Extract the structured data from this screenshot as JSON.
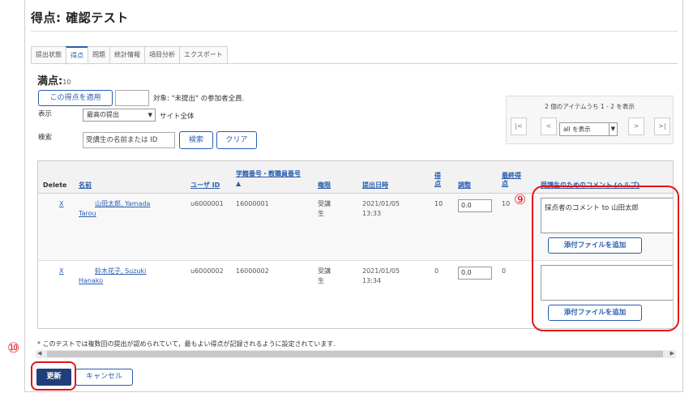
{
  "page": {
    "title": "得点: 確認テスト"
  },
  "tabs": [
    {
      "label": "提出状態",
      "active": false
    },
    {
      "label": "得点",
      "active": true
    },
    {
      "label": "問題",
      "active": false
    },
    {
      "label": "統計情報",
      "active": false
    },
    {
      "label": "項目分析",
      "active": false
    },
    {
      "label": "エクスポート",
      "active": false
    }
  ],
  "fullmarks": {
    "label": "満点:",
    "value": "10"
  },
  "apply": {
    "button": "この得点を適用",
    "value": "",
    "note": "対象: \"未提出\" の参加者全員."
  },
  "display": {
    "label": "表示",
    "selected": "最高の提出",
    "scope": "サイト全体"
  },
  "search": {
    "label": "検索",
    "placeholder": "受講生の名前または ID",
    "button": "検索",
    "clear": "クリア"
  },
  "pager": {
    "info": "2 個のアイテムうち 1 - 2 を表示",
    "first": "|<",
    "prev": "<",
    "next": ">",
    "last": ">|",
    "show_selected": "all を表示"
  },
  "table": {
    "headers": {
      "delete": "Delete",
      "name": "名前",
      "user_id": "ユーザ ID",
      "student_no": "学籍番号・教職員番号",
      "sort": "▲",
      "role": "権限",
      "submitted": "提出日時",
      "score_1": "得",
      "score_2": "点",
      "adjust": "調整",
      "final_1": "最終得",
      "final_2": "点",
      "comment": "受講生のためのコメント (ヘルプ)"
    },
    "rows": [
      {
        "delete": "X",
        "name_1": "山田太郎, Yamada",
        "name_2": "Tarou",
        "user_id": "u6000001",
        "student_no": "16000001",
        "role_1": "受講",
        "role_2": "生",
        "date": "2021/01/05",
        "time": "13:33",
        "score": "10",
        "adjust": "0.0",
        "final": "10",
        "comment": "採点者のコメント to 山田太郎",
        "attach": "添付ファイルを追加"
      },
      {
        "delete": "X",
        "name_1": "鈴木花子, Suzuki",
        "name_2": "Hanako",
        "user_id": "u6000002",
        "student_no": "16000002",
        "role_1": "受講",
        "role_2": "生",
        "date": "2021/01/05",
        "time": "13:34",
        "score": "0",
        "adjust": "0.0",
        "final": "0",
        "comment": "",
        "attach": "添付ファイルを追加"
      }
    ]
  },
  "footnote": "* このテストでは複数回の提出が認められていて，最もよい得点が記録されるように設定されています.",
  "actions": {
    "save": "更新",
    "cancel": "キャンセル"
  },
  "annotations": {
    "nine": "⑨",
    "ten": "⑩",
    "color": "#e21515"
  }
}
